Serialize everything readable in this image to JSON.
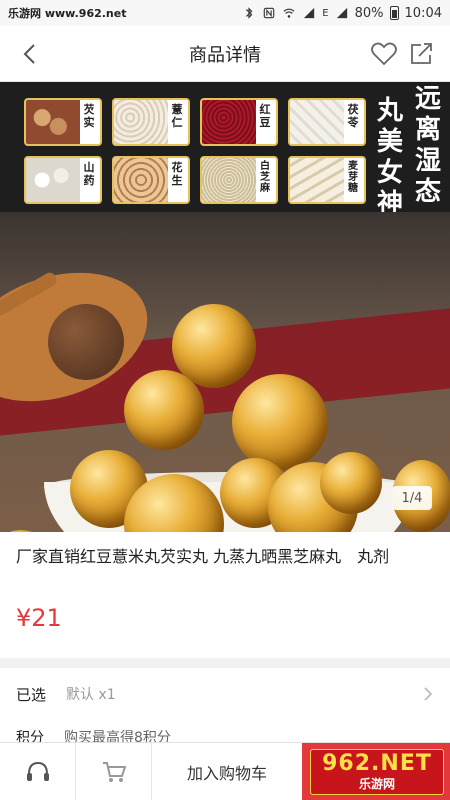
{
  "status_bar": {
    "watermark": "乐游网 www.962.net",
    "battery": "80%",
    "time": "10:04",
    "network": "E"
  },
  "nav": {
    "title": "商品详情"
  },
  "hero": {
    "ingredients": [
      "芡实",
      "薏仁",
      "红豆",
      "茯苓",
      "山药",
      "花生",
      "白芝麻",
      "麦芽糖"
    ],
    "slogan_right": "远离湿态",
    "slogan_left": "丸美女神",
    "counter": "1/4"
  },
  "product": {
    "title": "厂家直销红豆薏米丸芡实丸 九蒸九晒黑芝麻丸　丸剂",
    "price": "¥21"
  },
  "spec": {
    "label": "已选",
    "value": "默认 x1"
  },
  "points": {
    "label": "积分",
    "value": "购买最高得8积分"
  },
  "bottom": {
    "cart_label": "加入购物车",
    "watermark_main": "962.NET",
    "watermark_sub": "乐游网"
  },
  "colors": {
    "accent": "#e4393c",
    "gold": "#e9b03a"
  }
}
